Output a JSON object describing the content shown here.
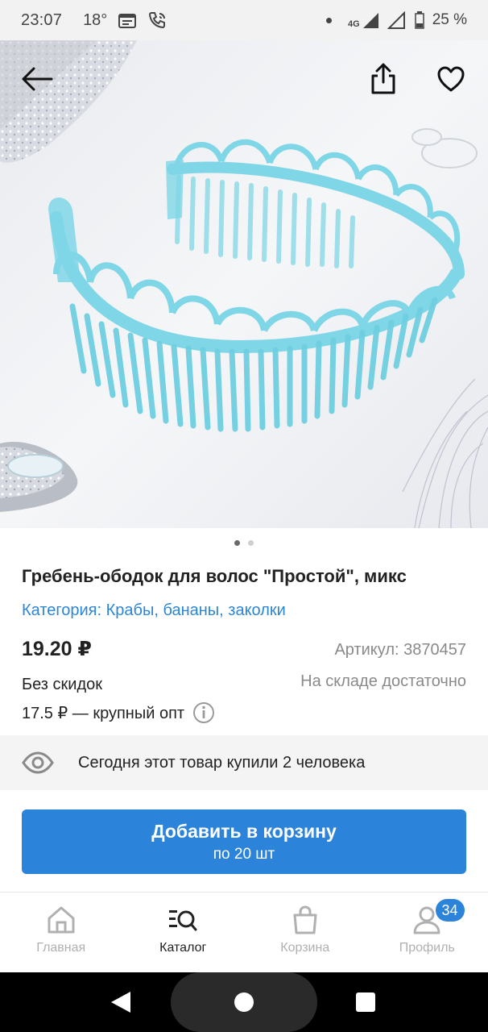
{
  "status_bar": {
    "time": "23:07",
    "temperature": "18°",
    "network": "4G",
    "battery": "25 %"
  },
  "hero": {
    "dots_total": 2,
    "dots_active": 0
  },
  "product": {
    "title": "Гребень-ободок для волос \"Простой\", микс",
    "category": "Категория: Крабы, бананы, заколки",
    "price": "19.20 ₽",
    "article": "Артикул: 3870457",
    "discount": "Без скидок",
    "stock": "На складе достаточно",
    "wholesale": "17.5 ₽ — крупный опт"
  },
  "bought": {
    "text": "Сегодня этот товар купили 2 человека"
  },
  "cart_button": {
    "label": "Добавить в корзину",
    "sub_label": "по 20 шт"
  },
  "tabbar": {
    "tabs": [
      {
        "label": "Главная",
        "icon": "home-icon"
      },
      {
        "label": "Каталог",
        "icon": "catalog-search-icon"
      },
      {
        "label": "Корзина",
        "icon": "shopping-bag-icon"
      },
      {
        "label": "Профиль",
        "icon": "profile-icon"
      }
    ],
    "active_index": 1,
    "profile_badge": "34"
  },
  "colors": {
    "accent": "#2b84d9",
    "link": "#2b86d6",
    "product": "#7fd6e6"
  }
}
